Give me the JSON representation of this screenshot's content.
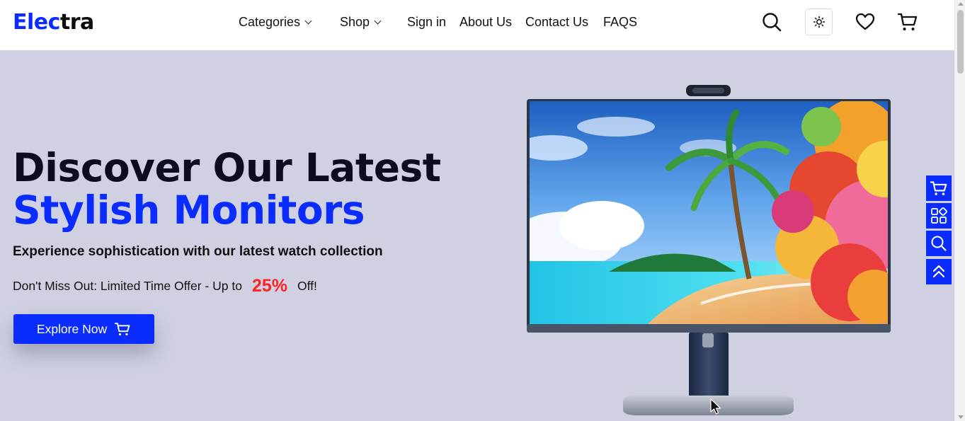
{
  "brand": {
    "logo_part1": "Elec",
    "logo_part2": "tra",
    "accent_color": "#0a2cff",
    "dark_color": "#0d0d0d"
  },
  "nav": {
    "items": [
      {
        "label": "Categories",
        "has_dropdown": true
      },
      {
        "label": "Shop",
        "has_dropdown": true
      },
      {
        "label": "Sign in",
        "has_dropdown": false
      },
      {
        "label": "About Us",
        "has_dropdown": false
      },
      {
        "label": "Contact Us",
        "has_dropdown": false
      },
      {
        "label": "FAQS",
        "has_dropdown": false
      }
    ]
  },
  "header_icons": [
    "search-icon",
    "sun-icon",
    "heart-icon",
    "cart-icon"
  ],
  "hero": {
    "title_line1": "Discover Our Latest",
    "title_line2": "Stylish Monitors",
    "subtitle": "Experience sophistication with our latest watch collection",
    "offer_prefix": "Don't Miss Out: Limited Time Offer - Up to",
    "offer_percent": "25%",
    "offer_suffix": "Off!",
    "cta_label": "Explore Now",
    "background_color": "#cfd1e3",
    "offer_color": "#ff2323"
  },
  "floating_actions": [
    "cart-icon",
    "apps-icon",
    "search-icon",
    "scroll-top-icon"
  ]
}
